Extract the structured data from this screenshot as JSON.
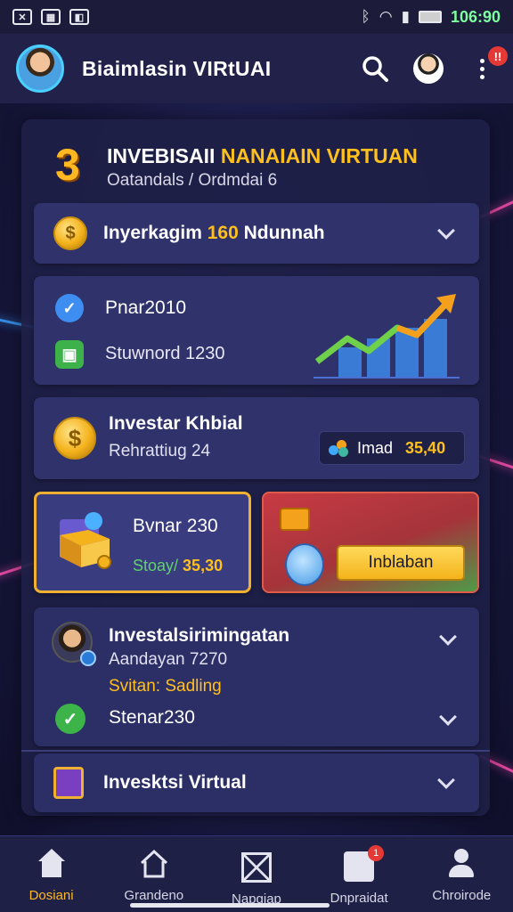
{
  "status_bar": {
    "time": "106:90"
  },
  "header": {
    "title": "Biaimlasin VIRtUAI",
    "notification_count": "!!"
  },
  "panel": {
    "number": "3",
    "title_main": "INVEBISAII ",
    "title_highlight": "NANAIAIN VIRTUAN",
    "subtitle": "Oatandals / Ordmdai 6"
  },
  "cards": {
    "invest_row": {
      "label_prefix": "Inyerkagim ",
      "label_value": "160",
      "label_suffix": " Ndunnah"
    },
    "stats": {
      "row1": "Pnar2010",
      "row2": "Stuwnord 1230"
    },
    "investor": {
      "title": "Investar Khbial",
      "subtitle": "Rehrattiug 24",
      "pill_label": "Imad",
      "pill_value": "35,40"
    },
    "box_card": {
      "title": "Bvnar 230",
      "key": "Stoay/",
      "value": "35,30"
    },
    "action_card": {
      "button_label": "Inblaban"
    },
    "detail": {
      "title": "Investalsirimingatan",
      "line1": "Aandayan 7270",
      "line2": "Svitan: Sadling",
      "row_label": "Stenar230"
    },
    "virtual": {
      "label": "Invesktsi Virtual"
    }
  },
  "bottom_nav": {
    "items": [
      {
        "label": "Dosiani",
        "active": true
      },
      {
        "label": "Grandeno",
        "active": false
      },
      {
        "label": "Napgiap",
        "active": false
      },
      {
        "label": "Dnpraidat",
        "active": false
      },
      {
        "label": "Chroirode",
        "active": false
      }
    ],
    "badge": "1"
  },
  "colors": {
    "accent": "#ffc01e",
    "active_nav": "#ffb820",
    "panel_bg": "#1e2046",
    "card_bg": "#30326c",
    "success": "#3db24a",
    "info": "#3d8ef0",
    "danger": "#e53935"
  },
  "icons": [
    "x-icon",
    "qr-icon",
    "shield-icon",
    "bluetooth-icon",
    "wifi-icon",
    "signal-icon",
    "battery-icon",
    "search-icon",
    "profile-icon",
    "more-icon",
    "coin-icon",
    "check-icon",
    "chart-icon",
    "box-icon",
    "mascot-icon",
    "home-icon",
    "house-outline-icon",
    "mail-icon",
    "card-icon",
    "user-icon"
  ]
}
